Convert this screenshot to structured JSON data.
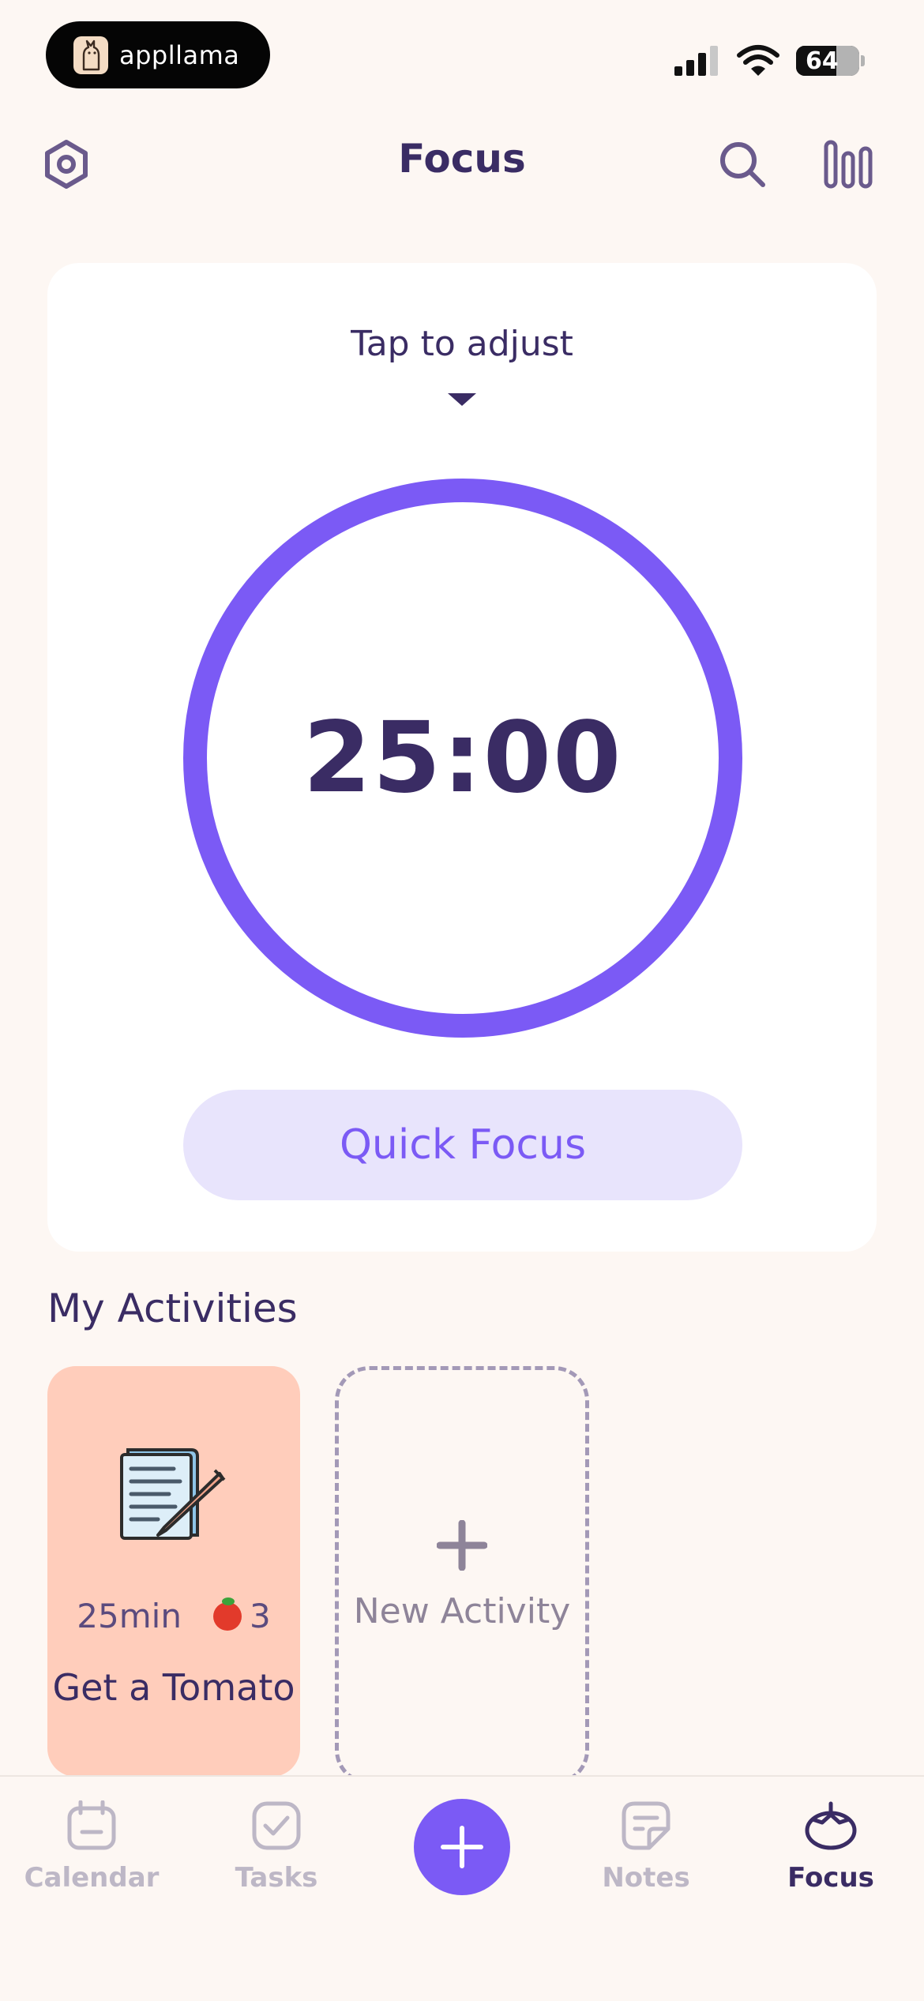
{
  "status_bar": {
    "brand": "appllama",
    "battery_level": 64,
    "battery_text": "64"
  },
  "header": {
    "title": "Focus",
    "left_icon": "settings-icon",
    "right_icons": [
      "search-icon",
      "stats-icon"
    ]
  },
  "timer": {
    "adjust_label": "Tap to adjust",
    "time": "25:00",
    "quick_focus_label": "Quick Focus"
  },
  "activities": {
    "section_title": "My Activities",
    "items": [
      {
        "icon": "notepad-icon",
        "duration": "25min",
        "tomato_count": "3",
        "name": "Get a Tomato",
        "bg_color": "#FFCDBB"
      }
    ],
    "new_activity_label": "New Activity"
  },
  "tab_bar": {
    "tabs": [
      {
        "label": "Calendar",
        "icon": "calendar-icon",
        "active": false
      },
      {
        "label": "Tasks",
        "icon": "tasks-icon",
        "active": false
      },
      {
        "label": "Notes",
        "icon": "notes-icon",
        "active": false
      },
      {
        "label": "Focus",
        "icon": "tomato-icon",
        "active": true
      }
    ],
    "center_action_icon": "plus-icon"
  },
  "colors": {
    "accent": "#7B5AF5",
    "text": "#3A2C64",
    "background": "#FDF7F3",
    "quick_focus_bg": "#E8E4FC"
  }
}
